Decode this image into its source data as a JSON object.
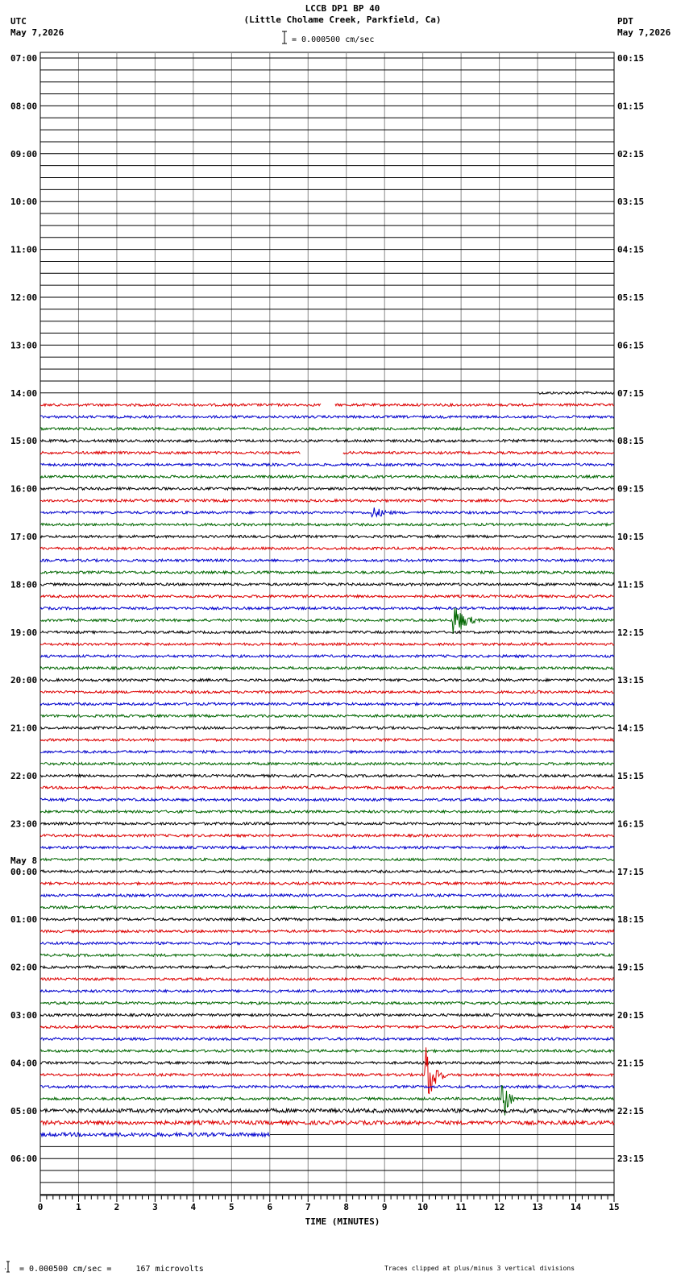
{
  "header": {
    "title": "LCCB DP1 BP 40",
    "subtitle": "(Little Cholame Creek, Parkfield, Ca)",
    "scale_text": "= 0.000500 cm/sec",
    "left_tz": "UTC",
    "left_date": "May 7,2026",
    "right_tz": "PDT",
    "right_date": "May 7,2026"
  },
  "footer": {
    "scale_text": "= 0.000500 cm/sec =     167 microvolts",
    "clip_note": "Traces clipped at plus/minus 3 vertical divisions"
  },
  "chart_data": {
    "type": "line",
    "xlabel": "TIME (MINUTES)",
    "x_ticks": [
      "0",
      "1",
      "2",
      "3",
      "4",
      "5",
      "6",
      "7",
      "8",
      "9",
      "10",
      "11",
      "12",
      "13",
      "14",
      "15"
    ],
    "xlim": [
      0,
      15
    ],
    "rows_per_hour": 4,
    "total_rows": 96,
    "left_labels": [
      {
        "row": 0,
        "text": "07:00"
      },
      {
        "row": 4,
        "text": "08:00"
      },
      {
        "row": 8,
        "text": "09:00"
      },
      {
        "row": 12,
        "text": "10:00"
      },
      {
        "row": 16,
        "text": "11:00"
      },
      {
        "row": 20,
        "text": "12:00"
      },
      {
        "row": 24,
        "text": "13:00"
      },
      {
        "row": 28,
        "text": "14:00"
      },
      {
        "row": 32,
        "text": "15:00"
      },
      {
        "row": 36,
        "text": "16:00"
      },
      {
        "row": 40,
        "text": "17:00"
      },
      {
        "row": 44,
        "text": "18:00"
      },
      {
        "row": 48,
        "text": "19:00"
      },
      {
        "row": 52,
        "text": "20:00"
      },
      {
        "row": 56,
        "text": "21:00"
      },
      {
        "row": 60,
        "text": "22:00"
      },
      {
        "row": 64,
        "text": "23:00"
      },
      {
        "row": 68,
        "text": "00:00"
      },
      {
        "row": 72,
        "text": "01:00"
      },
      {
        "row": 76,
        "text": "02:00"
      },
      {
        "row": 80,
        "text": "03:00"
      },
      {
        "row": 84,
        "text": "04:00"
      },
      {
        "row": 88,
        "text": "05:00"
      },
      {
        "row": 92,
        "text": "06:00"
      }
    ],
    "date_change_label": {
      "row": 68,
      "text": "May 8"
    },
    "right_labels": [
      {
        "row": 0,
        "text": "00:15"
      },
      {
        "row": 4,
        "text": "01:15"
      },
      {
        "row": 8,
        "text": "02:15"
      },
      {
        "row": 12,
        "text": "03:15"
      },
      {
        "row": 16,
        "text": "04:15"
      },
      {
        "row": 20,
        "text": "05:15"
      },
      {
        "row": 24,
        "text": "06:15"
      },
      {
        "row": 28,
        "text": "07:15"
      },
      {
        "row": 32,
        "text": "08:15"
      },
      {
        "row": 36,
        "text": "09:15"
      },
      {
        "row": 40,
        "text": "10:15"
      },
      {
        "row": 44,
        "text": "11:15"
      },
      {
        "row": 48,
        "text": "12:15"
      },
      {
        "row": 52,
        "text": "13:15"
      },
      {
        "row": 56,
        "text": "14:15"
      },
      {
        "row": 60,
        "text": "15:15"
      },
      {
        "row": 64,
        "text": "16:15"
      },
      {
        "row": 68,
        "text": "17:15"
      },
      {
        "row": 72,
        "text": "18:15"
      },
      {
        "row": 76,
        "text": "19:15"
      },
      {
        "row": 80,
        "text": "20:15"
      },
      {
        "row": 84,
        "text": "21:15"
      },
      {
        "row": 88,
        "text": "22:15"
      },
      {
        "row": 92,
        "text": "23:15"
      }
    ],
    "trace_colors": [
      "#000000",
      "#dd0000",
      "#0000cc",
      "#006600"
    ],
    "data_start": {
      "row": 28,
      "minute": 13
    },
    "data_end": {
      "row": 90,
      "minute": 6
    },
    "events": [
      {
        "row": 38,
        "minute": 8.7,
        "amplitude": 0.5,
        "duration": 1.0
      },
      {
        "row": 47,
        "minute": 10.8,
        "amplitude": 1.6,
        "duration": 0.7
      },
      {
        "row": 85,
        "minute": 10.1,
        "amplitude": 3.0,
        "duration": 0.5
      },
      {
        "row": 87,
        "minute": 12.1,
        "amplitude": 3.0,
        "duration": 0.3
      }
    ],
    "gaps": [
      {
        "row": 29,
        "from": 7.35,
        "to": 7.7
      },
      {
        "row": 33,
        "from": 6.8,
        "to": 7.9
      }
    ]
  }
}
